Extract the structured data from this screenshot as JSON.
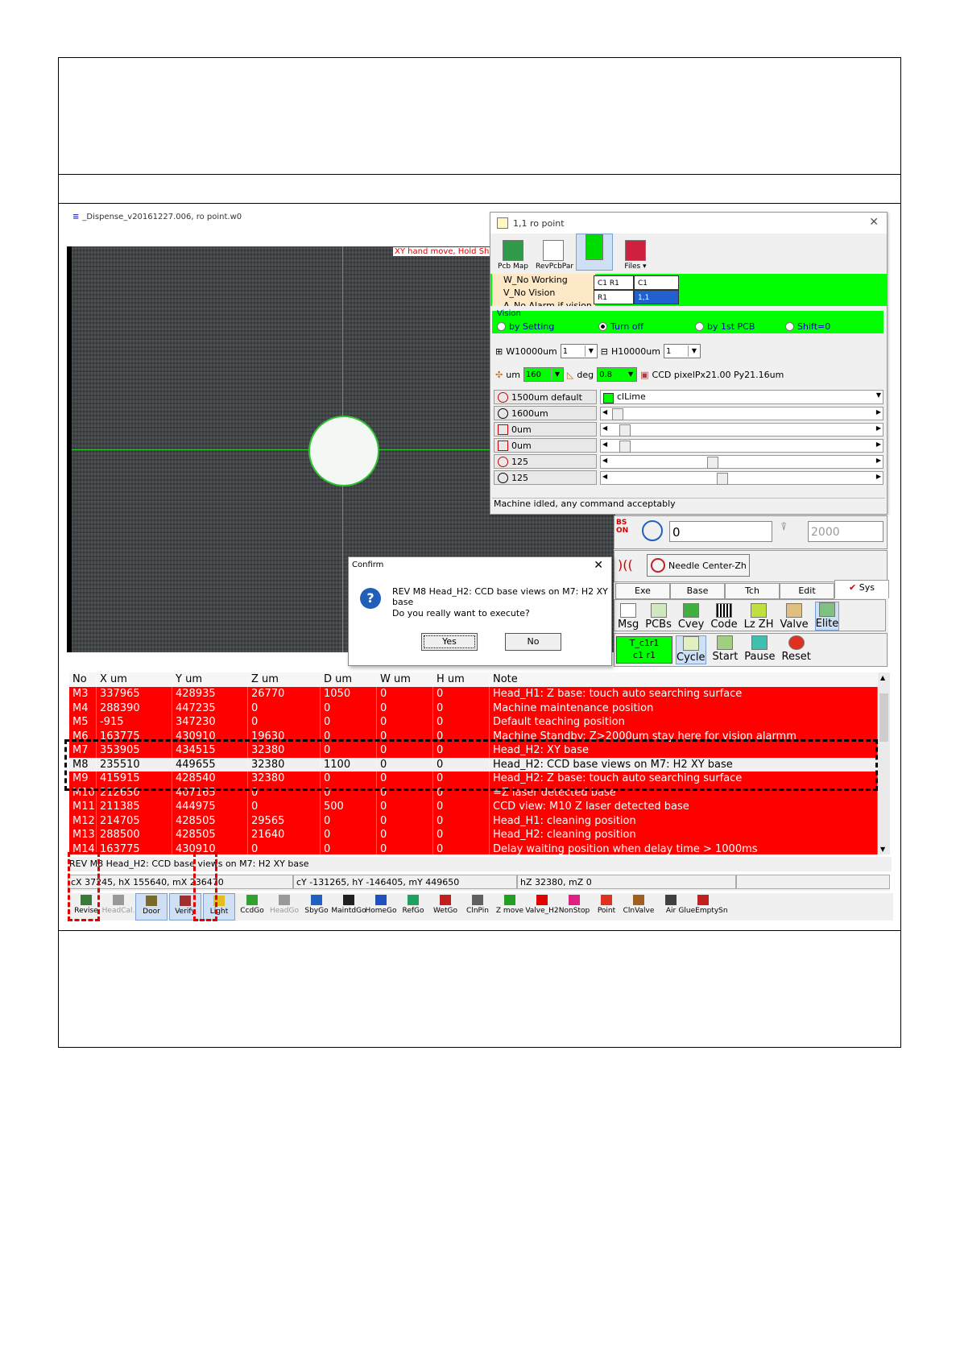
{
  "app": {
    "title": "_Dispense_v20161227.006, ro point.w0",
    "hint": "XY hand move, Hold Shift k"
  },
  "vision_window": {
    "title": "1,1  ro point",
    "toolbar": [
      "Pcb Map",
      "RevPcbPar",
      "",
      "Files"
    ],
    "checks": [
      "W_No Working",
      "V_No Vision",
      "A_No Alarm if vision e"
    ],
    "grid": {
      "c1r1": "C1 R1",
      "c1": "C1",
      "r1": "R1",
      "v11": "1,1"
    },
    "vision_legend": "Vision",
    "radios": [
      {
        "label": "by Setting",
        "on": false
      },
      {
        "label": "Turn off",
        "on": true
      },
      {
        "label": "by 1st PCB",
        "on": false
      },
      {
        "label": "Shift=0",
        "on": false
      }
    ],
    "w_label": "W10000um",
    "w_value": "1",
    "h_label": "H10000um",
    "h_value": "1",
    "um_label": "um",
    "um_value": "160",
    "deg_label": "deg",
    "deg_value": "0.8",
    "ccd_label": "CCD pixelPx21.00 Py21.16um",
    "props": [
      "1500um default",
      "1600um",
      "0um",
      "0um",
      "125",
      "125"
    ],
    "color_value": "clLime",
    "slider_levels": [
      0.17,
      0.0,
      0.03,
      0.03,
      0.38,
      0.42
    ],
    "status": "Machine idled, any command acceptably"
  },
  "right_panel": {
    "bs_label": "BS ON",
    "input_value": "0",
    "input_value2": "2000",
    "needle_label": "Needle Center-Zh",
    "tabs": [
      "Exe",
      "Base",
      "Tch",
      "Edit",
      "Sys"
    ],
    "buttons": [
      "Msg",
      "PCBs",
      "Cvey",
      "Code",
      "Lz ZH",
      "Valve",
      "Elite"
    ],
    "tcell_top": "T_c1r1",
    "tcell_bottom": "c1 r1",
    "actions": [
      "Cycle",
      "Start",
      "Pause",
      "Reset"
    ]
  },
  "confirm": {
    "title": "Confirm",
    "message": "REV M8 Head_H2: CCD base views on M7: H2 XY base",
    "question": "Do you really want to execute?",
    "yes": "Yes",
    "no": "No"
  },
  "table": {
    "headers": [
      "No",
      "X um",
      "Y um",
      "Z um",
      "D um",
      "W um",
      "H um",
      "Note"
    ],
    "rows": [
      {
        "cells": [
          "M3",
          "337965",
          "428935",
          "26770",
          "1050",
          "0",
          "0",
          "Head_H1: Z base: touch auto searching surface"
        ],
        "style": "red"
      },
      {
        "cells": [
          "M4",
          "288390",
          "447235",
          "0",
          "0",
          "0",
          "0",
          "Machine maintenance position"
        ],
        "style": "red"
      },
      {
        "cells": [
          "M5",
          "-915",
          "347230",
          "0",
          "0",
          "0",
          "0",
          "Default teaching position"
        ],
        "style": "red"
      },
      {
        "cells": [
          "M6",
          "163775",
          "430910",
          "19630",
          "0",
          "0",
          "0",
          "Machine Standby: Z>2000um stay here for vision alarmm"
        ],
        "style": "red"
      },
      {
        "cells": [
          "M7",
          "353905",
          "434515",
          "32380",
          "0",
          "0",
          "0",
          "Head_H2: XY base"
        ],
        "style": "red"
      },
      {
        "cells": [
          "M8",
          "235510",
          "449655",
          "32380",
          "1100",
          "0",
          "0",
          "Head_H2: CCD base views on M7: H2 XY base"
        ],
        "style": "white"
      },
      {
        "cells": [
          "M9",
          "415915",
          "428540",
          "32380",
          "0",
          "0",
          "0",
          "Head_H2: Z base: touch auto searching surface"
        ],
        "style": "red"
      },
      {
        "cells": [
          "M10",
          "212630",
          "407165",
          "0",
          "0",
          "0",
          "0",
          "=Z laser detected base"
        ],
        "style": "red"
      },
      {
        "cells": [
          "M11",
          "211385",
          "444975",
          "0",
          "500",
          "0",
          "0",
          "CCD view: M10 Z laser detected base"
        ],
        "style": "red"
      },
      {
        "cells": [
          "M12",
          "214705",
          "428505",
          "29565",
          "0",
          "0",
          "0",
          "Head_H1: cleaning position"
        ],
        "style": "red"
      },
      {
        "cells": [
          "M13",
          "288500",
          "428505",
          "21640",
          "0",
          "0",
          "0",
          "Head_H2: cleaning position"
        ],
        "style": "red"
      },
      {
        "cells": [
          "M14",
          "163775",
          "430910",
          "0",
          "0",
          "0",
          "0",
          "Delay waiting position when delay time > 1000ms"
        ],
        "style": "red"
      }
    ]
  },
  "statusbar": {
    "line": "REV M8 Head_H2: CCD base views on M7: H2 XY base",
    "cx": "cX 37245, hX 155640, mX 236470",
    "cy": "cY -131265, hY -146405, mY 449650",
    "hz": "hZ 32380, mZ 0"
  },
  "bottom_toolbar": [
    {
      "label": "Revise",
      "state": "normal",
      "color": "#3a7a3a"
    },
    {
      "label": "HeadCal.",
      "state": "disabled",
      "color": "#999999"
    },
    {
      "label": "Door",
      "state": "pressed",
      "color": "#7a6a2a"
    },
    {
      "label": "Verify",
      "state": "pressed",
      "color": "#a03030"
    },
    {
      "label": "Light",
      "state": "pressed",
      "color": "#e0c020"
    },
    {
      "label": "CcdGo",
      "state": "normal",
      "color": "#30a030"
    },
    {
      "label": "HeadGo",
      "state": "disabled",
      "color": "#999999"
    },
    {
      "label": "SbyGo",
      "state": "normal",
      "color": "#2060c0"
    },
    {
      "label": "MaintdGo",
      "state": "normal",
      "color": "#202020"
    },
    {
      "label": "HomeGo",
      "state": "normal",
      "color": "#2050c0"
    },
    {
      "label": "RefGo",
      "state": "normal",
      "color": "#20a060"
    },
    {
      "label": "WetGo",
      "state": "normal",
      "color": "#c02020"
    },
    {
      "label": "ClnPin",
      "state": "normal",
      "color": "#606060"
    },
    {
      "label": "Z move",
      "state": "normal",
      "color": "#20a020"
    },
    {
      "label": "Valve_H2",
      "state": "normal",
      "color": "#e00000"
    },
    {
      "label": "NonStop",
      "state": "normal",
      "color": "#e02080"
    },
    {
      "label": "Point",
      "state": "normal",
      "color": "#e03020"
    },
    {
      "label": "ClnValve",
      "state": "normal",
      "color": "#a06020"
    },
    {
      "label": "Air",
      "state": "normal",
      "color": "#404040"
    },
    {
      "label": "GlueEmptySn",
      "state": "normal",
      "color": "#c02020"
    }
  ],
  "colors": {
    "alarm_row": "#ff0000",
    "lime": "#00ff00",
    "crosshair": "#2fc42f"
  }
}
